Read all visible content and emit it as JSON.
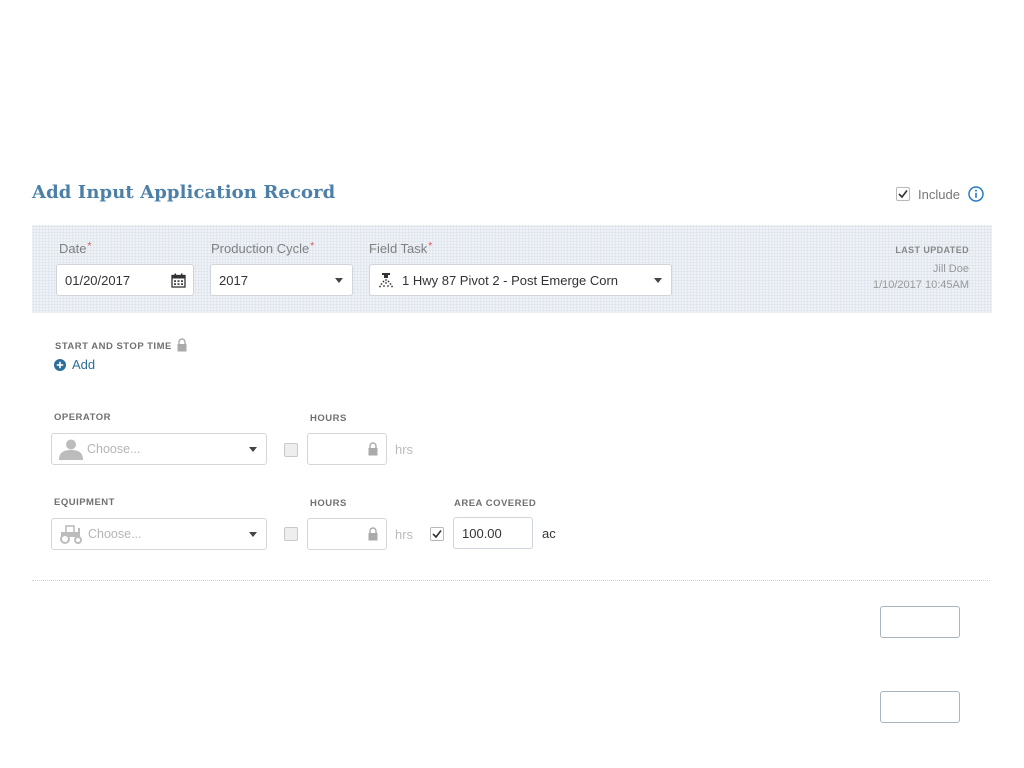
{
  "title": "Add Input Application Record",
  "include": {
    "label": "Include",
    "checked": true
  },
  "date": {
    "label": "Date",
    "value": "01/20/2017"
  },
  "production_cycle": {
    "label": "Production Cycle",
    "value": "2017"
  },
  "field_task": {
    "label": "Field Task",
    "value": "1 Hwy 87 Pivot 2 - Post Emerge Corn"
  },
  "required_marker": "*",
  "last_updated": {
    "label": "LAST UPDATED",
    "user": "Jill Doe",
    "timestamp": "1/10/2017 10:45AM"
  },
  "start_stop": {
    "label": "START AND STOP TIME",
    "add_label": "Add"
  },
  "operator": {
    "label": "OPERATOR",
    "placeholder": "Choose...",
    "hours_label": "HOURS",
    "hours_unit": "hrs"
  },
  "equipment": {
    "label": "EQUIPMENT",
    "placeholder": "Choose...",
    "hours_label": "HOURS",
    "hours_unit": "hrs"
  },
  "area_covered": {
    "label": "AREA COVERED",
    "value": "100.00",
    "unit": "ac",
    "checked": true
  },
  "colors": {
    "title": "#4d80a8",
    "link": "#2c6e9b",
    "required": "#d9534f",
    "panel": "#eef2f6"
  }
}
